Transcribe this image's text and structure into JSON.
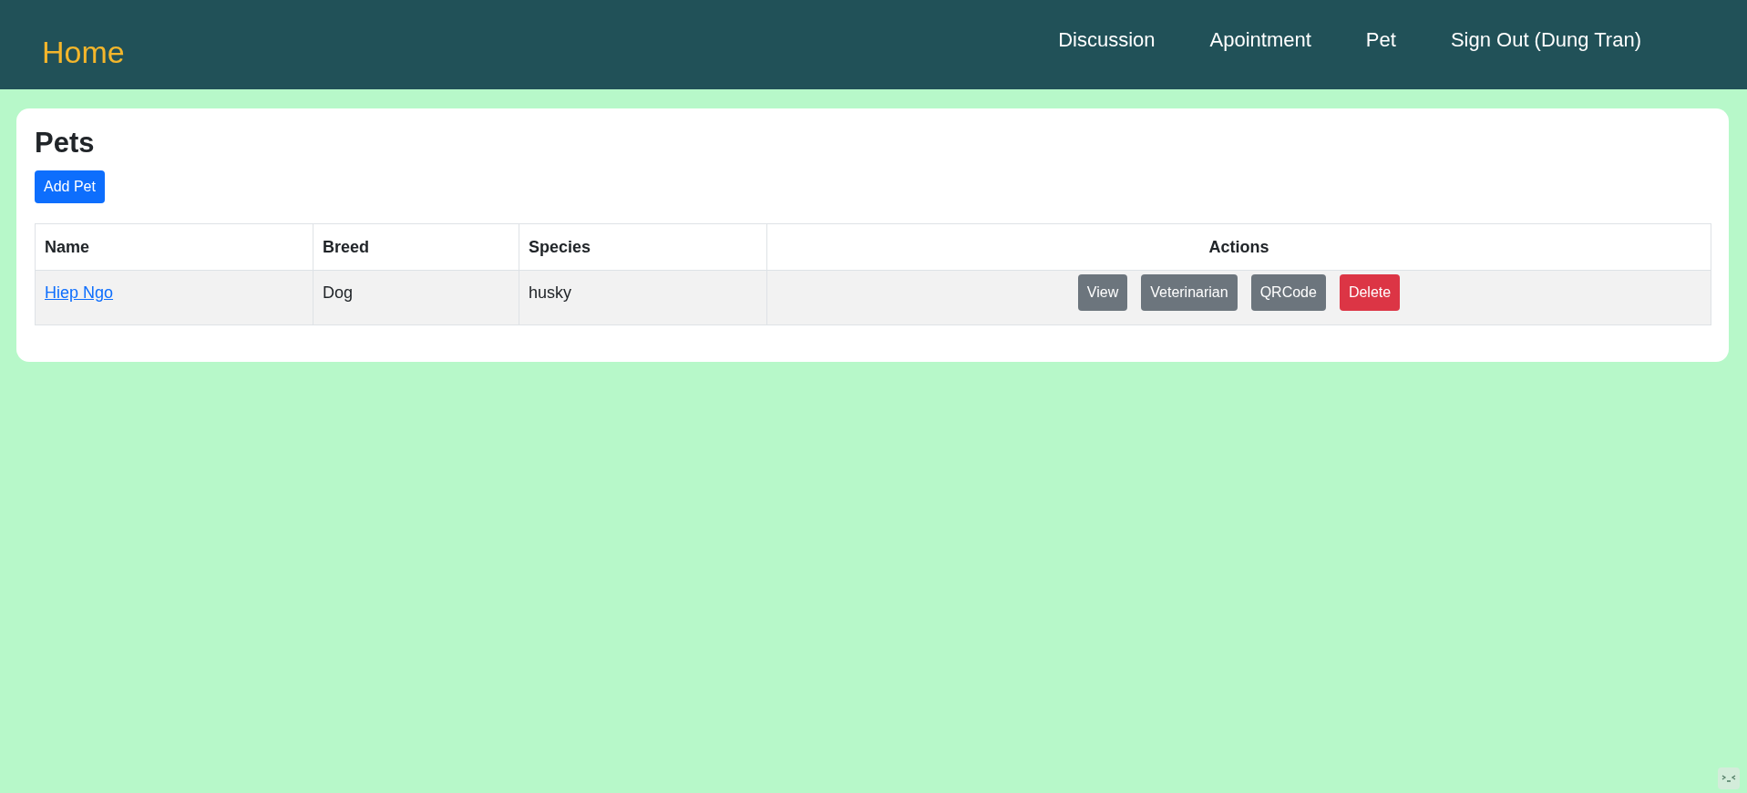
{
  "navbar": {
    "brand": "Home",
    "links": [
      "Discussion",
      "Apointment",
      "Pet",
      "Sign Out (Dung Tran)"
    ]
  },
  "page": {
    "title": "Pets",
    "add_button": "Add Pet"
  },
  "table": {
    "columns": [
      "Name",
      "Breed",
      "Species",
      "Actions"
    ],
    "rows": [
      {
        "name": "Hiep Ngo",
        "breed": "Dog",
        "species": "husky",
        "actions": [
          {
            "label": "View",
            "kind": "secondary"
          },
          {
            "label": "Veterinarian",
            "kind": "secondary"
          },
          {
            "label": "QRCode",
            "kind": "secondary"
          },
          {
            "label": "Delete",
            "kind": "danger"
          }
        ]
      }
    ]
  }
}
